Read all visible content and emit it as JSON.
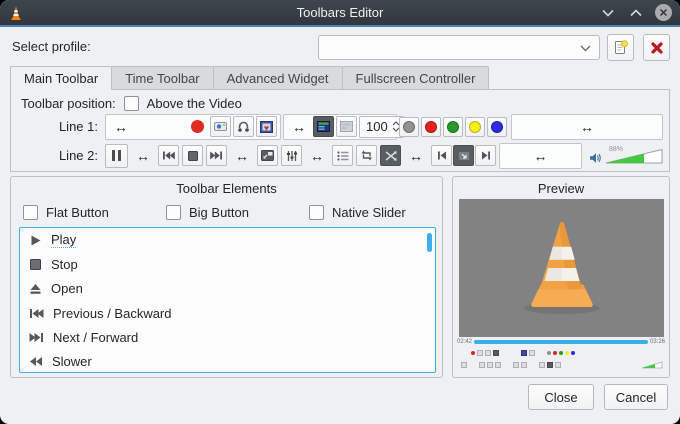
{
  "window": {
    "title": "Toolbars Editor"
  },
  "profile": {
    "label": "Select profile:",
    "value": ""
  },
  "tabs": {
    "main": "Main Toolbar",
    "time": "Time Toolbar",
    "advanced": "Advanced Widget",
    "fullscreen": "Fullscreen Controller"
  },
  "main_tab": {
    "position_label": "Toolbar position:",
    "position_option": "Above the Video",
    "position_checked": false,
    "line1_label": "Line 1:",
    "line2_label": "Line 2:",
    "spinbox_value": "100",
    "dot_colors": [
      "#919191",
      "#e3211f",
      "#27992a",
      "#f4ef1b",
      "#2d2ddd"
    ],
    "volume_label": "88%",
    "volume_fill": "#3ecb3e",
    "volume_fill_width": "68%"
  },
  "elements": {
    "title": "Toolbar Elements",
    "checkboxes": [
      {
        "label": "Flat Button",
        "checked": false
      },
      {
        "label": "Big Button",
        "checked": false
      },
      {
        "label": "Native Slider",
        "checked": false
      }
    ],
    "items": [
      {
        "icon": "play-icon",
        "label": "Play"
      },
      {
        "icon": "stop-icon",
        "label": "Stop"
      },
      {
        "icon": "eject-icon",
        "label": "Open"
      },
      {
        "icon": "skip-backward-icon",
        "label": "Previous / Backward"
      },
      {
        "icon": "skip-forward-icon",
        "label": "Next / Forward"
      },
      {
        "icon": "rewind-icon",
        "label": "Slower"
      }
    ]
  },
  "preview": {
    "title": "Preview",
    "time_elapsed": "02:42",
    "time_total": "03:26"
  },
  "footer": {
    "close_label": "Close",
    "cancel_label": "Cancel"
  },
  "icons": {
    "spacer": "↔"
  },
  "colors": {
    "accent": "#3daee9",
    "record_red": "#e02b20",
    "titlebar": "#343a40"
  }
}
